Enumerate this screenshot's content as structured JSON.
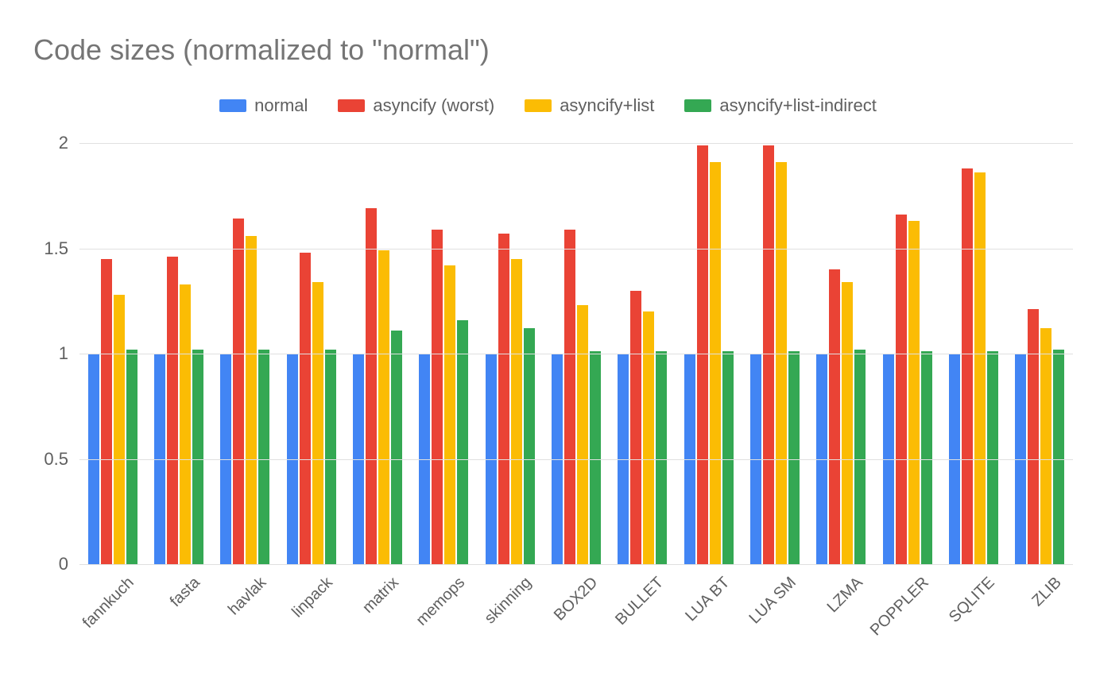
{
  "chart_data": {
    "type": "bar",
    "title": "Code sizes (normalized to \"normal\")",
    "xlabel": "",
    "ylabel": "",
    "ylim": [
      0,
      2
    ],
    "yticks": [
      0,
      0.5,
      1,
      1.5,
      2
    ],
    "categories": [
      "fannkuch",
      "fasta",
      "havlak",
      "linpack",
      "matrix",
      "memops",
      "skinning",
      "BOX2D",
      "BULLET",
      "LUA BT",
      "LUA SM",
      "LZMA",
      "POPPLER",
      "SQLITE",
      "ZLIB"
    ],
    "series": [
      {
        "name": "normal",
        "color": "#4285f4",
        "values": [
          1.0,
          1.0,
          1.0,
          1.0,
          1.0,
          1.0,
          1.0,
          1.0,
          1.0,
          1.0,
          1.0,
          1.0,
          1.0,
          1.0,
          1.0
        ]
      },
      {
        "name": "asyncify (worst)",
        "color": "#ea4335",
        "values": [
          1.45,
          1.46,
          1.64,
          1.48,
          1.69,
          1.59,
          1.57,
          1.59,
          1.3,
          1.99,
          1.99,
          1.4,
          1.66,
          1.88,
          1.21
        ]
      },
      {
        "name": "asyncify+list",
        "color": "#fbbc04",
        "values": [
          1.28,
          1.33,
          1.56,
          1.34,
          1.49,
          1.42,
          1.45,
          1.23,
          1.2,
          1.91,
          1.91,
          1.34,
          1.63,
          1.86,
          1.12
        ]
      },
      {
        "name": "asyncify+list-indirect",
        "color": "#34a853",
        "values": [
          1.02,
          1.02,
          1.02,
          1.02,
          1.11,
          1.16,
          1.12,
          1.01,
          1.01,
          1.01,
          1.01,
          1.02,
          1.01,
          1.01,
          1.02
        ]
      }
    ]
  }
}
